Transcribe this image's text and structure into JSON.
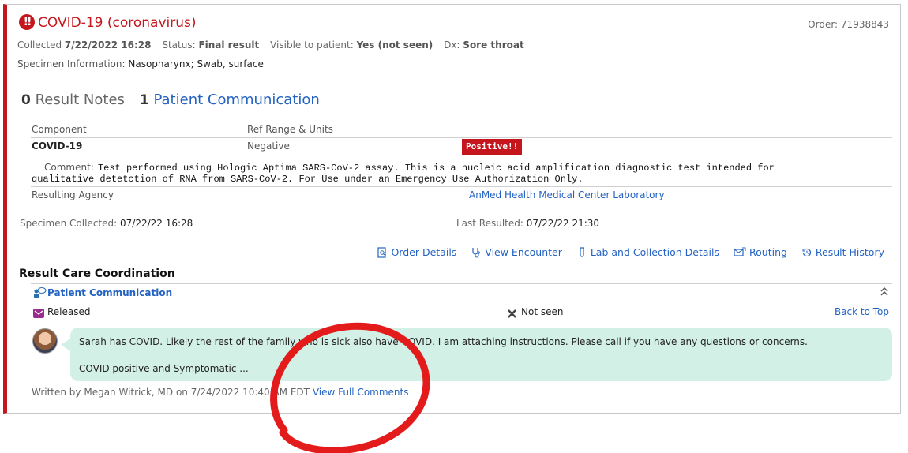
{
  "result": {
    "title": "COVID-19 (coronavirus)",
    "alert_glyph": "!!",
    "order_label": "Order:",
    "order_number": "71938843",
    "collected_label": "Collected",
    "collected_value": "7/22/2022 16:28",
    "status_label": "Status:",
    "status_value": "Final result",
    "visible_label": "Visible to patient:",
    "visible_value": "Yes (not seen)",
    "dx_label": "Dx:",
    "dx_value": "Sore throat",
    "specimen_label": "Specimen Information:",
    "specimen_value": "Nasopharynx; Swab, surface"
  },
  "tabs": [
    {
      "count": "0",
      "label": "Result Notes"
    },
    {
      "count": "1",
      "label": "Patient Communication"
    }
  ],
  "table": {
    "headers": [
      "Component",
      "Ref Range & Units"
    ],
    "row": {
      "component": "COVID-19",
      "ref_range": "Negative",
      "value": "Positive",
      "flag": "!!"
    },
    "comment_label": "Comment:",
    "comment_line1": "Test performed using Hologic Aptima SARS-CoV-2 assay. This is a nucleic acid amplification diagnostic test intended for",
    "comment_line2": "qualitative detetction of RNA from SARS-CoV-2. For Use under an Emergency Use Authorization Only.",
    "agency_label": "Resulting Agency",
    "agency_value": "AnMed Health Medical Center Laboratory"
  },
  "times": {
    "collected_label": "Specimen Collected:",
    "collected_value": "07/22/22 16:28",
    "resulted_label": "Last Resulted:",
    "resulted_value": "07/22/22 21:30"
  },
  "actions": [
    "Order Details",
    "View Encounter",
    "Lab and Collection Details",
    "Routing",
    "Result History"
  ],
  "coordination": {
    "section_title": "Result Care Coordination",
    "pc_label": "Patient Communication",
    "released": "Released",
    "not_seen": "Not seen",
    "back_to_top": "Back to Top",
    "message_line1": "Sarah has COVID. Likely the rest of the family who is sick also have COVID. I am attaching instructions. Please call if you have any questions or concerns.",
    "message_line2": "COVID positive and Symptomatic  ...",
    "written_by": "Written by Megan Witrick, MD on 7/24/2022 10:40 AM EDT",
    "view_full_comments": "View Full Comments"
  },
  "colors": {
    "accent_red": "#c4161c",
    "link_blue": "#2463c2",
    "bubble_green": "#d2f0e6",
    "annotation_red": "#e31b1b"
  }
}
